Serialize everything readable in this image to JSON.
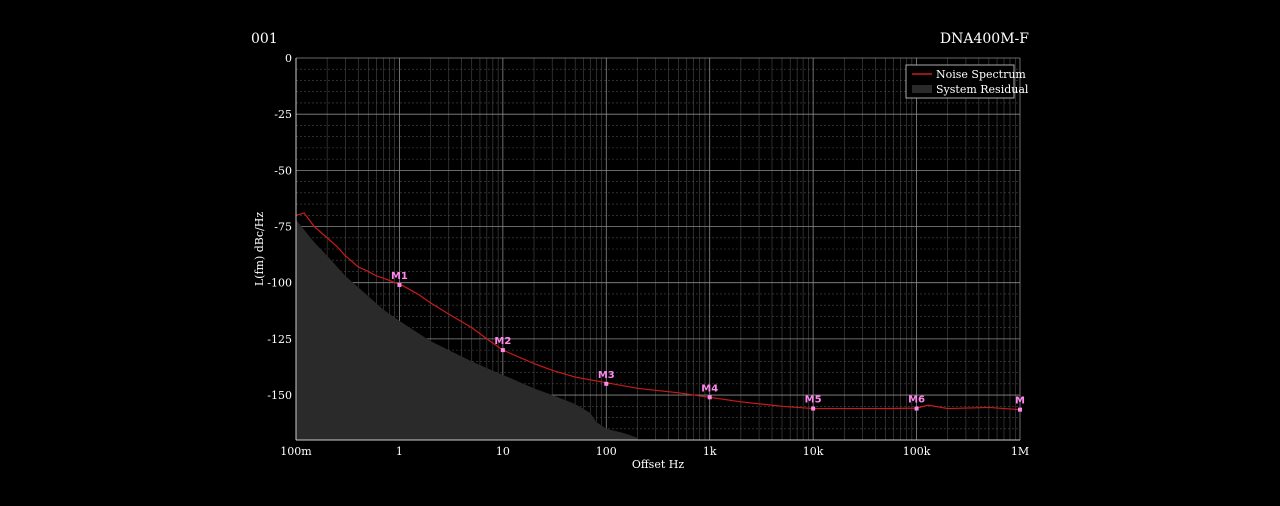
{
  "header": {
    "left_label": "001",
    "right_label": "DNA400M-F"
  },
  "chart_data": {
    "type": "line",
    "xlabel": "Offset Hz",
    "ylabel": "L(fm) dBc/Hz",
    "x_scale": "log",
    "xlim": [
      0.1,
      1000000
    ],
    "ylim": [
      -170,
      0
    ],
    "x_ticks": [
      {
        "value": 0.1,
        "label": "100m"
      },
      {
        "value": 1,
        "label": "1"
      },
      {
        "value": 10,
        "label": "10"
      },
      {
        "value": 100,
        "label": "100"
      },
      {
        "value": 1000,
        "label": "1k"
      },
      {
        "value": 10000,
        "label": "10k"
      },
      {
        "value": 100000,
        "label": "100k"
      },
      {
        "value": 1000000,
        "label": "1M"
      }
    ],
    "y_ticks": [
      {
        "value": 0,
        "label": "0"
      },
      {
        "value": -25,
        "label": "-25"
      },
      {
        "value": -50,
        "label": "-50"
      },
      {
        "value": -75,
        "label": "-75"
      },
      {
        "value": -100,
        "label": "-100"
      },
      {
        "value": -125,
        "label": "-125"
      },
      {
        "value": -150,
        "label": "-150"
      }
    ],
    "grid": true,
    "legend_position": "top-right",
    "colors": {
      "noise": "#cc1a1a",
      "residual": "#2a2a2a",
      "marker": "#ff88ee",
      "grid_major": "#8a8a8a",
      "grid_minor": "#4a4a4a"
    },
    "series": [
      {
        "name": "Noise Spectrum",
        "kind": "line",
        "x": [
          0.1,
          0.12,
          0.15,
          0.2,
          0.25,
          0.3,
          0.4,
          0.5,
          0.6,
          0.7,
          0.8,
          0.9,
          1,
          1.5,
          2,
          3,
          5,
          7,
          10,
          20,
          30,
          50,
          100,
          200,
          500,
          1000,
          2000,
          5000,
          10000,
          20000,
          50000,
          100000,
          130000,
          200000,
          500000,
          1000000
        ],
        "y": [
          -70,
          -69,
          -75,
          -80,
          -84,
          -88,
          -93,
          -95,
          -97,
          -98,
          -99,
          -100,
          -100.5,
          -105,
          -109,
          -114,
          -120,
          -125,
          -130,
          -136,
          -139,
          -142,
          -144.5,
          -147,
          -149,
          -151,
          -153,
          -155,
          -156,
          -156,
          -156,
          -155.8,
          -154.5,
          -156,
          -155.5,
          -156.5
        ]
      },
      {
        "name": "System Residual",
        "kind": "area",
        "x": [
          0.1,
          0.15,
          0.2,
          0.3,
          0.5,
          0.7,
          1,
          2,
          3,
          5,
          7,
          10,
          20,
          30,
          50,
          70,
          80,
          100,
          150,
          200
        ],
        "y": [
          -72,
          -82,
          -88,
          -97,
          -106,
          -112,
          -117,
          -126,
          -130,
          -135,
          -138,
          -141,
          -147,
          -150,
          -154,
          -158,
          -162,
          -165,
          -167,
          -169
        ]
      }
    ],
    "markers": [
      {
        "label": "M1",
        "x": 1,
        "y": -101
      },
      {
        "label": "M2",
        "x": 10,
        "y": -130
      },
      {
        "label": "M3",
        "x": 100,
        "y": -145
      },
      {
        "label": "M4",
        "x": 1000,
        "y": -151
      },
      {
        "label": "M5",
        "x": 10000,
        "y": -156
      },
      {
        "label": "M6",
        "x": 100000,
        "y": -156
      },
      {
        "label": "M",
        "x": 1000000,
        "y": -156.5
      }
    ]
  }
}
